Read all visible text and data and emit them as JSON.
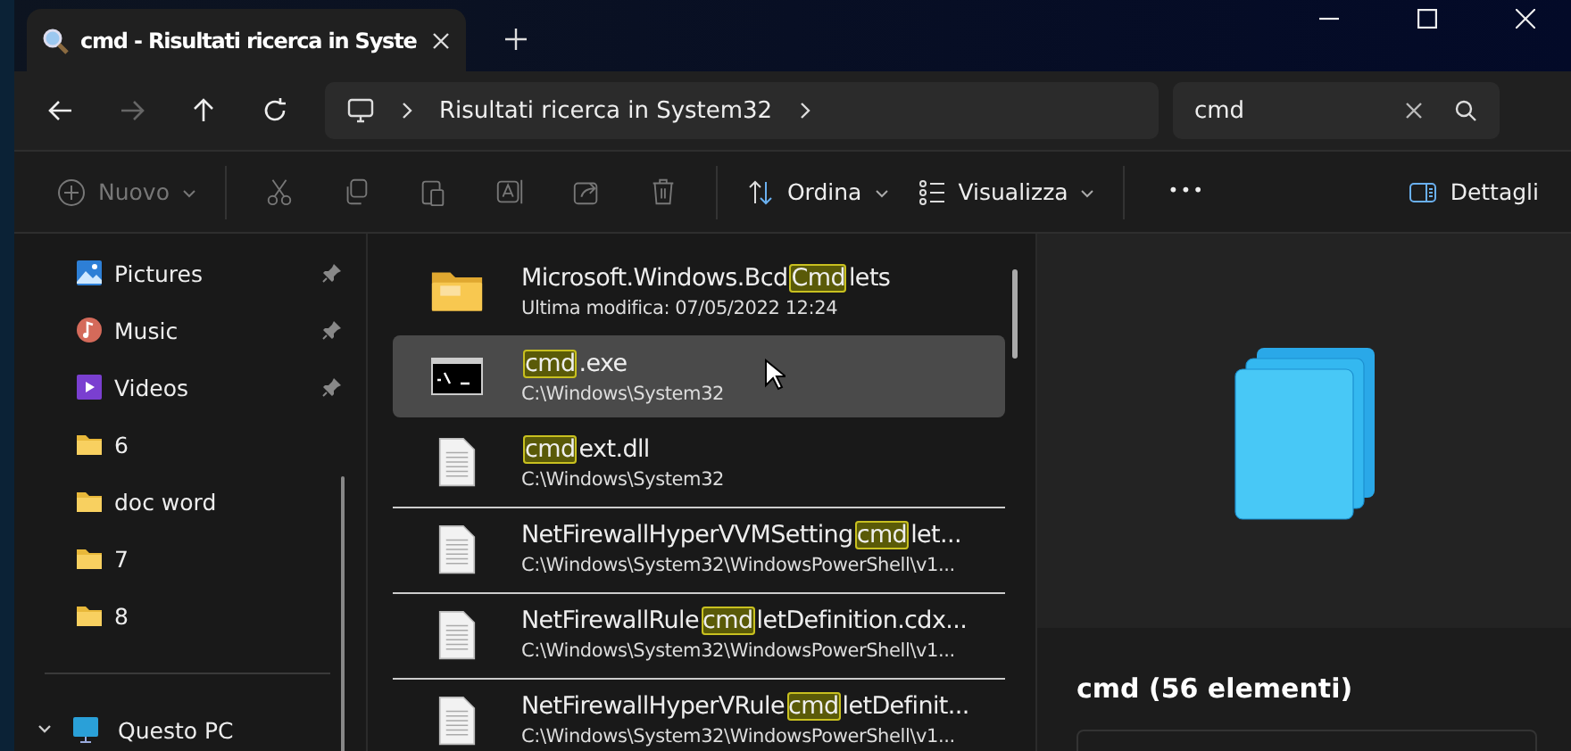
{
  "tab": {
    "title": "cmd - Risultati ricerca in Syste",
    "selected": true
  },
  "address": {
    "crumbs": [
      "Risultati ricerca in System32"
    ]
  },
  "search": {
    "value": "cmd"
  },
  "toolbar": {
    "new_label": "Nuovo",
    "sort_label": "Ordina",
    "view_label": "Visualizza",
    "more_label": "•••",
    "details_label": "Dettagli"
  },
  "sidebar": {
    "items": [
      {
        "label": "Pictures",
        "kind": "pictures",
        "pinned": true
      },
      {
        "label": "Music",
        "kind": "music",
        "pinned": true
      },
      {
        "label": "Videos",
        "kind": "videos",
        "pinned": true
      },
      {
        "label": "6",
        "kind": "folder",
        "pinned": false
      },
      {
        "label": "doc word",
        "kind": "folder",
        "pinned": false
      },
      {
        "label": "7",
        "kind": "folder",
        "pinned": false
      },
      {
        "label": "8",
        "kind": "folder",
        "pinned": false
      }
    ],
    "this_pc": {
      "label": "Questo PC",
      "expanded": true
    }
  },
  "files": [
    {
      "kind": "folder",
      "selected": false,
      "divider": false,
      "name": [
        {
          "text": "Microsoft.Windows.Bcd",
          "match": false
        },
        {
          "text": "Cmd",
          "match": true
        },
        {
          "text": "lets",
          "match": false
        }
      ],
      "detail": "Ultima modifica: 07/05/2022 12:24"
    },
    {
      "kind": "console",
      "selected": true,
      "divider": false,
      "name": [
        {
          "text": "cmd",
          "match": true
        },
        {
          "text": ".exe",
          "match": false
        }
      ],
      "detail": "C:\\Windows\\System32"
    },
    {
      "kind": "document",
      "selected": false,
      "divider": false,
      "name": [
        {
          "text": "cmd",
          "match": true
        },
        {
          "text": "ext.dll",
          "match": false
        }
      ],
      "detail": "C:\\Windows\\System32"
    },
    {
      "kind": "document",
      "selected": false,
      "divider": true,
      "name": [
        {
          "text": "NetFirewallHyperVVMSetting",
          "match": false
        },
        {
          "text": "cmd",
          "match": true
        },
        {
          "text": "let...",
          "match": false
        }
      ],
      "detail": "C:\\Windows\\System32\\WindowsPowerShell\\v1..."
    },
    {
      "kind": "document",
      "selected": false,
      "divider": true,
      "name": [
        {
          "text": "NetFirewallRule",
          "match": false
        },
        {
          "text": "cmd",
          "match": true
        },
        {
          "text": "letDefinition.cdx...",
          "match": false
        }
      ],
      "detail": "C:\\Windows\\System32\\WindowsPowerShell\\v1..."
    },
    {
      "kind": "document",
      "selected": false,
      "divider": true,
      "name": [
        {
          "text": "NetFirewallHyperVRule",
          "match": false
        },
        {
          "text": "cmd",
          "match": true
        },
        {
          "text": "letDefinit...",
          "match": false
        }
      ],
      "detail": "C:\\Windows\\System32\\WindowsPowerShell\\v1..."
    }
  ],
  "details_pane": {
    "title": "cmd (56 elementi)"
  }
}
